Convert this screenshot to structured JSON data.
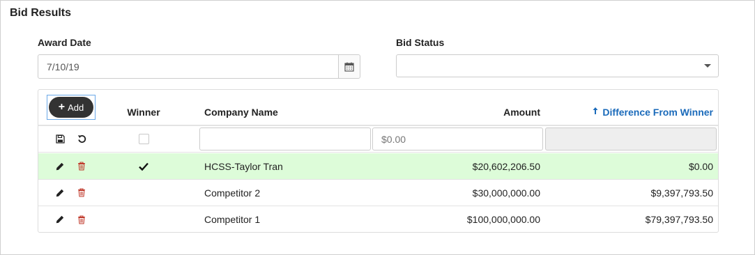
{
  "panel": {
    "title": "Bid Results"
  },
  "form": {
    "award_date_label": "Award Date",
    "award_date_value": "7/10/19",
    "bid_status_label": "Bid Status",
    "bid_status_value": ""
  },
  "grid": {
    "add_label": "Add",
    "headers": {
      "winner": "Winner",
      "company": "Company Name",
      "amount": "Amount",
      "difference": "Difference From Winner"
    },
    "edit_row": {
      "amount_placeholder": "$0.00"
    },
    "rows": [
      {
        "winner": true,
        "company": "HCSS-Taylor Tran",
        "amount": "$20,602,206.50",
        "difference": "$0.00"
      },
      {
        "winner": false,
        "company": "Competitor 2",
        "amount": "$30,000,000.00",
        "difference": "$9,397,793.50"
      },
      {
        "winner": false,
        "company": "Competitor 1",
        "amount": "$100,000,000.00",
        "difference": "$79,397,793.50"
      }
    ]
  },
  "colors": {
    "winner_row_bg": "#ddfcd9",
    "sort_link": "#1a6aba",
    "delete_icon": "#c0392b",
    "add_button_bg": "#333333"
  },
  "icons": {
    "calendar": "calendar-icon",
    "save": "floppy-disk-icon",
    "undo": "undo-icon",
    "edit": "pencil-icon",
    "delete": "trash-icon",
    "winner": "checkmark-icon",
    "sort": "arrow-up-icon"
  }
}
